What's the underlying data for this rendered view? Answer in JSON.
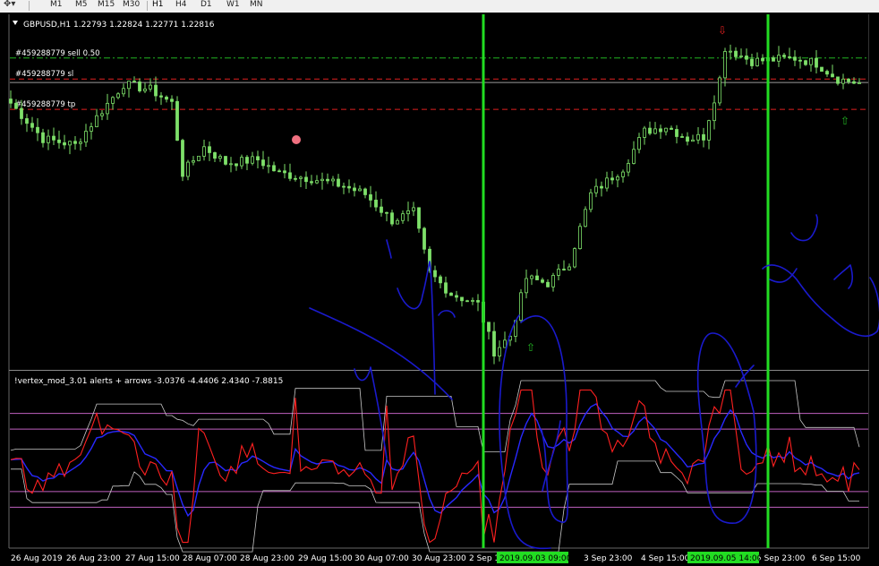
{
  "toolbar": {
    "tool_icon": "cursor-drag-icon",
    "timeframes": [
      "M1",
      "M5",
      "M15",
      "M30",
      "H1",
      "H4",
      "D1",
      "W1",
      "MN"
    ],
    "active_timeframe": "H1"
  },
  "main_pane": {
    "header_text": "GBPUSD,H1  1.22793 1.22824 1.22771 1.22816",
    "order_lines": [
      {
        "label": "#459288779 sell 0.50",
        "price": 1.2305,
        "color": "#22b422",
        "style": "dash-dot"
      },
      {
        "label": "#459288779 sl",
        "price": 1.2285,
        "color": "#e02020",
        "style": "dashed"
      },
      {
        "label": "#459288779 tp",
        "price": 1.2256,
        "color": "#e02020",
        "style": "dashed"
      }
    ],
    "current_price": 1.22816
  },
  "indicator_pane": {
    "header_text": "!vertex_mod_3.01 alerts + arrows -3.0376 -4.4406 2.4340 -7.8815",
    "levels": [
      6,
      4,
      -4,
      -6
    ]
  },
  "time_axis": {
    "labels": [
      "26 Aug 2019",
      "26 Aug 23:00",
      "27 Aug 15:00",
      "28 Aug 07:00",
      "28 Aug 23:00",
      "29 Aug 15:00",
      "30 Aug 07:00",
      "30 Aug 23:00",
      "2 Sep 1",
      "3 Sep 23:00",
      "4 Sep 15:00",
      "5 Sep 23:00",
      "6 Sep 15:00"
    ],
    "highlight_labels": [
      {
        "text": "2019.09.03 09:00",
        "bar": 88
      },
      {
        "text": "2019.09.05 14:00",
        "bar": 141
      }
    ]
  },
  "colors": {
    "background": "#000000",
    "candle": "#7ee06a",
    "vline": "#22dd22",
    "indicator_red": "#ff2020",
    "indicator_blue": "#2828ff",
    "bands": "#c8c8c8",
    "levels": "#c060c0",
    "annotation": "#1a1acc"
  },
  "chart_data": {
    "type": "candlestick",
    "symbol": "GBPUSD",
    "timeframe": "H1",
    "x_start": "26 Aug 2019",
    "close_series": [
      {
        "bar": 0,
        "price": 1.2262
      },
      {
        "bar": 6,
        "price": 1.2228
      },
      {
        "bar": 12,
        "price": 1.2222
      },
      {
        "bar": 17,
        "price": 1.2255
      },
      {
        "bar": 21,
        "price": 1.228
      },
      {
        "bar": 26,
        "price": 1.2275
      },
      {
        "bar": 30,
        "price": 1.2262
      },
      {
        "bar": 32,
        "price": 1.2195
      },
      {
        "bar": 36,
        "price": 1.222
      },
      {
        "bar": 40,
        "price": 1.2205
      },
      {
        "bar": 46,
        "price": 1.2208
      },
      {
        "bar": 50,
        "price": 1.2195
      },
      {
        "bar": 56,
        "price": 1.219
      },
      {
        "bar": 62,
        "price": 1.2183
      },
      {
        "bar": 66,
        "price": 1.2175
      },
      {
        "bar": 71,
        "price": 1.215
      },
      {
        "bar": 75,
        "price": 1.2158
      },
      {
        "bar": 78,
        "price": 1.21
      },
      {
        "bar": 82,
        "price": 1.208
      },
      {
        "bar": 87,
        "price": 1.207
      },
      {
        "bar": 90,
        "price": 1.2025
      },
      {
        "bar": 93,
        "price": 1.204
      },
      {
        "bar": 96,
        "price": 1.2095
      },
      {
        "bar": 100,
        "price": 1.209
      },
      {
        "bar": 104,
        "price": 1.211
      },
      {
        "bar": 108,
        "price": 1.2175
      },
      {
        "bar": 114,
        "price": 1.22
      },
      {
        "bar": 118,
        "price": 1.2235
      },
      {
        "bar": 122,
        "price": 1.224
      },
      {
        "bar": 126,
        "price": 1.2228
      },
      {
        "bar": 129,
        "price": 1.223
      },
      {
        "bar": 132,
        "price": 1.2285
      },
      {
        "bar": 133,
        "price": 1.2315
      },
      {
        "bar": 138,
        "price": 1.2302
      },
      {
        "bar": 146,
        "price": 1.2305
      },
      {
        "bar": 150,
        "price": 1.23
      },
      {
        "bar": 154,
        "price": 1.2285
      },
      {
        "bar": 158,
        "price": 1.2281
      }
    ],
    "marked_bars": [
      88,
      141
    ],
    "ylim": [
      1.201,
      1.2345
    ]
  }
}
